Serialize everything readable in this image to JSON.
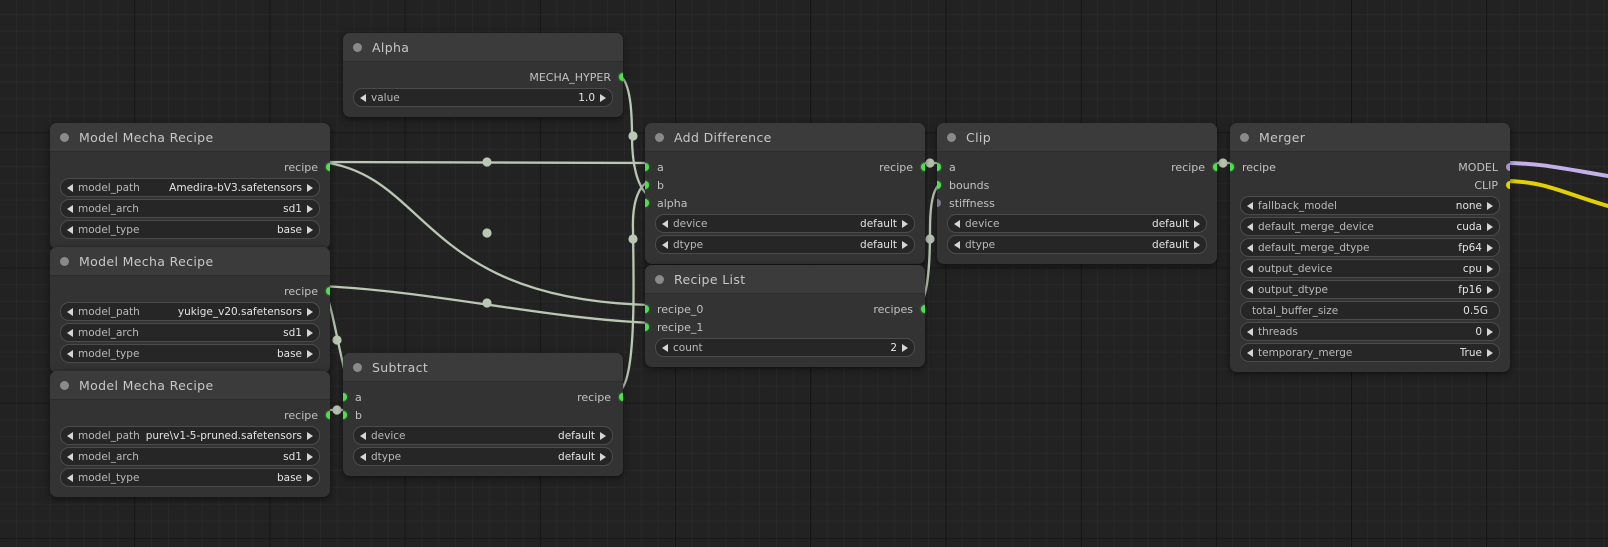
{
  "canvas": {
    "background": "#222222",
    "grid_color": "#2a2a2a",
    "wire_color": "#b9c7b3"
  },
  "colors": {
    "port_green": "#4ce04c",
    "port_grey": "#7b7b92",
    "port_purple": "#a98fd0",
    "port_yellow": "#e2d000",
    "node_body": "#333333",
    "node_header": "#3b3b3b"
  },
  "nodes": {
    "alpha": {
      "title": "Alpha",
      "outputs": [
        {
          "label": "MECHA_HYPER",
          "color": "green"
        }
      ],
      "widgets": [
        {
          "name": "value",
          "value": "1.0",
          "arrows": true
        }
      ]
    },
    "recipe1": {
      "title": "Model Mecha Recipe",
      "outputs": [
        {
          "label": "recipe",
          "color": "green"
        }
      ],
      "widgets": [
        {
          "name": "model_path",
          "value": "Amedira-bV3.safetensors",
          "arrows": true
        },
        {
          "name": "model_arch",
          "value": "sd1",
          "arrows": true
        },
        {
          "name": "model_type",
          "value": "base",
          "arrows": true
        }
      ]
    },
    "recipe2": {
      "title": "Model Mecha Recipe",
      "outputs": [
        {
          "label": "recipe",
          "color": "green"
        }
      ],
      "widgets": [
        {
          "name": "model_path",
          "value": "yukige_v20.safetensors",
          "arrows": true
        },
        {
          "name": "model_arch",
          "value": "sd1",
          "arrows": true
        },
        {
          "name": "model_type",
          "value": "base",
          "arrows": true
        }
      ]
    },
    "recipe3": {
      "title": "Model Mecha Recipe",
      "outputs": [
        {
          "label": "recipe",
          "color": "green"
        }
      ],
      "widgets": [
        {
          "name": "model_path",
          "value": "pure\\v1-5-pruned.safetensors",
          "arrows": true
        },
        {
          "name": "model_arch",
          "value": "sd1",
          "arrows": true
        },
        {
          "name": "model_type",
          "value": "base",
          "arrows": true
        }
      ]
    },
    "subtract": {
      "title": "Subtract",
      "inputs": [
        {
          "label": "a",
          "color": "green"
        },
        {
          "label": "b",
          "color": "green"
        }
      ],
      "outputs": [
        {
          "label": "recipe",
          "color": "green"
        }
      ],
      "widgets": [
        {
          "name": "device",
          "value": "default",
          "arrows": true
        },
        {
          "name": "dtype",
          "value": "default",
          "arrows": true
        }
      ]
    },
    "add_difference": {
      "title": "Add Difference",
      "inputs": [
        {
          "label": "a",
          "color": "green"
        },
        {
          "label": "b",
          "color": "green"
        },
        {
          "label": "alpha",
          "color": "green"
        }
      ],
      "outputs": [
        {
          "label": "recipe",
          "color": "green"
        }
      ],
      "widgets": [
        {
          "name": "device",
          "value": "default",
          "arrows": true
        },
        {
          "name": "dtype",
          "value": "default",
          "arrows": true
        }
      ]
    },
    "recipe_list": {
      "title": "Recipe List",
      "inputs": [
        {
          "label": "recipe_0",
          "color": "green"
        },
        {
          "label": "recipe_1",
          "color": "green"
        }
      ],
      "outputs": [
        {
          "label": "recipes",
          "color": "green"
        }
      ],
      "widgets": [
        {
          "name": "count",
          "value": "2",
          "arrows": true
        }
      ]
    },
    "clip": {
      "title": "Clip",
      "inputs": [
        {
          "label": "a",
          "color": "green"
        },
        {
          "label": "bounds",
          "color": "green"
        },
        {
          "label": "stiffness",
          "color": "grey"
        }
      ],
      "outputs": [
        {
          "label": "recipe",
          "color": "green"
        }
      ],
      "widgets": [
        {
          "name": "device",
          "value": "default",
          "arrows": true
        },
        {
          "name": "dtype",
          "value": "default",
          "arrows": true
        }
      ]
    },
    "merger": {
      "title": "Merger",
      "inputs": [
        {
          "label": "recipe",
          "color": "green"
        }
      ],
      "outputs": [
        {
          "label": "MODEL",
          "color": "purple"
        },
        {
          "label": "CLIP",
          "color": "yellow"
        }
      ],
      "widgets": [
        {
          "name": "fallback_model",
          "value": "none",
          "arrows": true
        },
        {
          "name": "default_merge_device",
          "value": "cuda",
          "arrows": true
        },
        {
          "name": "default_merge_dtype",
          "value": "fp64",
          "arrows": true
        },
        {
          "name": "output_device",
          "value": "cpu",
          "arrows": true
        },
        {
          "name": "output_dtype",
          "value": "fp16",
          "arrows": true
        },
        {
          "name": "total_buffer_size",
          "value": "0.5G",
          "arrows": false
        },
        {
          "name": "threads",
          "value": "0",
          "arrows": true
        },
        {
          "name": "temporary_merge",
          "value": "True",
          "arrows": true
        }
      ]
    }
  }
}
